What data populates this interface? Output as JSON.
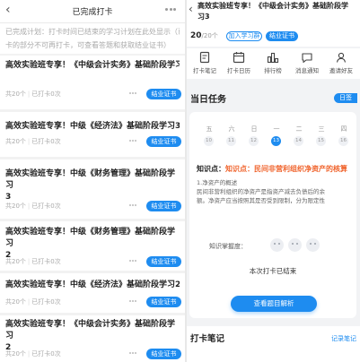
{
  "colors": {
    "accent": "#1e8cf0",
    "highlight": "#f0642d"
  },
  "left": {
    "header": {
      "back_icon": "‹",
      "title": "已完成打卡"
    },
    "notice_lines": [
      "已完成计划：打卡时间已结束的学习计划在此处显示（已打",
      "卡的部分不可再打卡，可查看答题和获取结业证书）"
    ],
    "cards": [
      {
        "title_lines": [
          "高效实验班专享！《中级会计实务》基础阶段学习"
        ],
        "total": "共20个",
        "punched": "已打卡0次",
        "cert": "结业证书"
      },
      {
        "title_lines": [
          "高效实验班专享！中级《经济法》基础阶段学习3"
        ],
        "total": "共20个",
        "punched": "已打卡0次",
        "cert": "结业证书"
      },
      {
        "title_lines": [
          "高效实验班专享！中级《财务管理》基础阶段学习",
          "3"
        ],
        "total": "共20个",
        "punched": "已打卡0次",
        "cert": "结业证书"
      },
      {
        "title_lines": [
          "高效实验班专享！中级《财务管理》基础阶段学习",
          "2"
        ],
        "total": "共20个",
        "punched": "已打卡0次",
        "cert": "结业证书"
      },
      {
        "title_lines": [
          "高效实验班专享！中级《经济法》基础阶段学习2"
        ],
        "total": "共20个",
        "punched": "已打卡0次",
        "cert": "结业证书"
      },
      {
        "title_lines": [
          "高效实验班专享！《中级会计实务》基础阶段学习",
          "2"
        ],
        "total": "共20个",
        "punched": "已打卡0次",
        "cert": "结业证书"
      }
    ]
  },
  "right": {
    "back_icon": "‹",
    "title": "高效实验班专享！《中级会计实务》基础阶段学习3",
    "count_num": "20",
    "count_unit": "/20个",
    "join_label": "加入学习群",
    "cert_label": "结业证书",
    "tools": [
      {
        "label": "打卡笔记",
        "icon": "note-icon"
      },
      {
        "label": "打卡日历",
        "icon": "calendar-icon"
      },
      {
        "label": "排行榜",
        "icon": "ranking-icon"
      },
      {
        "label": "消息通知",
        "icon": "message-icon"
      },
      {
        "label": "邀请好友",
        "icon": "invite-icon"
      }
    ],
    "task_title": "当日任务",
    "calendar_label": "日签",
    "weekdays": [
      "五",
      "六",
      "日",
      "一",
      "二",
      "三",
      "四"
    ],
    "days": [
      "10",
      "11",
      "12",
      "13",
      "14",
      "15",
      "16"
    ],
    "today_index": 3,
    "knowledge_prefix": "知识点：",
    "knowledge_text": "知识点：民间非营利组织净资产的核算",
    "content_lines": [
      "1.净资产的概述",
      "民间非营利组织的净资产是指资产减去负债后的余",
      "额。净资产应当按照其是否受到限制，分为限定性"
    ],
    "mastery_label": "知识掌握度：",
    "done_text": "本次打卡已结束",
    "view_button": "查看题目解析",
    "notes_title": "打卡笔记",
    "notes_write": "记录笔记"
  }
}
